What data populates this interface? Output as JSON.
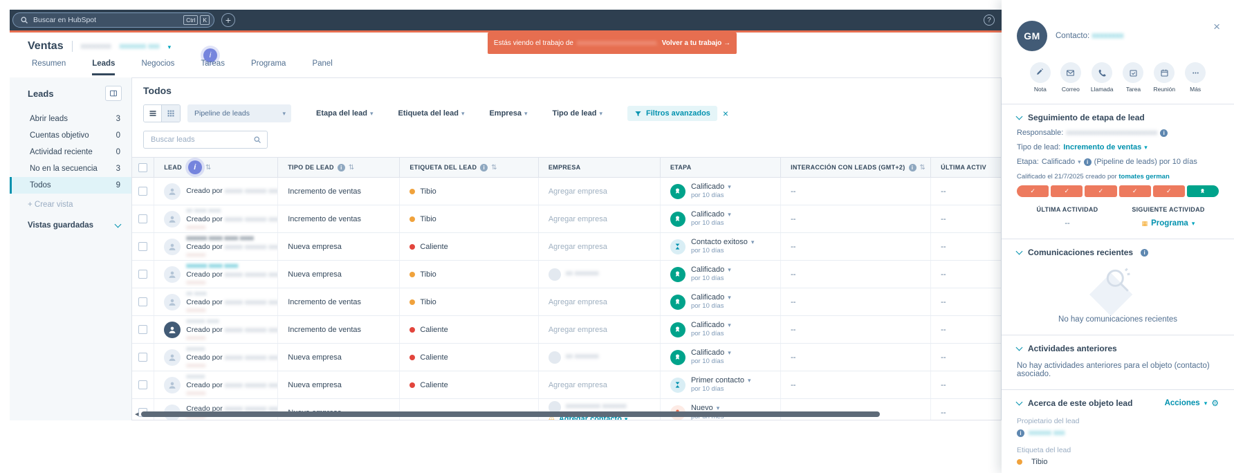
{
  "colors": {
    "navy": "#33475b",
    "teal": "#0091ae",
    "orange": "#e66e50",
    "green": "#00a38b",
    "amber": "#f5a623",
    "red": "#e2453c",
    "purple": "#7584dd"
  },
  "topbar": {
    "search_placeholder": "Buscar en HubSpot",
    "keys": [
      "Ctrl",
      "K"
    ]
  },
  "banner": {
    "prefix": "Estás viendo el trabajo de",
    "redacted": "xxxxxxxxxxxxxxxxxxxxxxx.",
    "action": "Volver a tu trabajo →"
  },
  "header": {
    "title": "Ventas",
    "sub1": "xxxxxxxx",
    "sub2": "xxxxxxx xxx",
    "tabs": [
      {
        "label": "Resumen",
        "active": false
      },
      {
        "label": "Leads",
        "active": true
      },
      {
        "label": "Negocios",
        "active": false
      },
      {
        "label": "Tareas",
        "active": false
      },
      {
        "label": "Programa",
        "active": false
      },
      {
        "label": "Panel",
        "active": false
      }
    ]
  },
  "sidebar": {
    "title": "Leads",
    "items": [
      {
        "label": "Abrir leads",
        "count": "3",
        "active": false
      },
      {
        "label": "Cuentas objetivo",
        "count": "0",
        "active": false
      },
      {
        "label": "Actividad reciente",
        "count": "0",
        "active": false
      },
      {
        "label": "No en la secuencia",
        "count": "3",
        "active": false
      },
      {
        "label": "Todos",
        "count": "9",
        "active": true
      }
    ],
    "create": "+ Crear vista",
    "saved": "Vistas guardadas"
  },
  "toolbar": {
    "heading": "Todos",
    "pipeline": "Pipeline de leads",
    "filters": [
      "Etapa del lead",
      "Etiqueta del lead",
      "Empresa",
      "Tipo de lead"
    ],
    "advanced": "Filtros avanzados",
    "search_placeholder": "Buscar leads"
  },
  "table": {
    "empty_value": "--",
    "columns": [
      {
        "label": "",
        "checkbox": true
      },
      {
        "label": "LEAD",
        "sort": true,
        "beacon": true
      },
      {
        "label": "TIPO DE LEAD",
        "info": true,
        "sort": true
      },
      {
        "label": "ETIQUETA DEL LEAD",
        "info": true,
        "sort": true
      },
      {
        "label": "EMPRESA"
      },
      {
        "label": "ETAPA"
      },
      {
        "label": "INTERACCIÓN CON LEADS (GMT+2)",
        "info": true,
        "sort": true
      },
      {
        "label": "ÚLTIMA ACTIV"
      }
    ],
    "rows": [
      {
        "avatar": "person",
        "name": "",
        "name_class": "",
        "creado": "Creado por",
        "creado_name": "xxxxx xxxxxx xxxxx",
        "sub": "",
        "tipo": "Incremento de ventas",
        "etiqueta": {
          "label": "Tibio",
          "color": "#f0a23c"
        },
        "empresa": {
          "type": "add",
          "label": "Agregar empresa"
        },
        "etapa": {
          "icon": "badge",
          "label": "Calificado",
          "sub": "por 10 días"
        },
        "interaccion": "--",
        "ultima": "--"
      },
      {
        "avatar": "person",
        "name": "xx xxxx xxxx",
        "name_class": "plain",
        "creado": "Creado por",
        "creado_name": "xxxxx xxxxxx xxxxx",
        "sub": "xxxxxxx",
        "tipo": "Incremento de ventas",
        "etiqueta": {
          "label": "Tibio",
          "color": "#f0a23c"
        },
        "empresa": {
          "type": "add",
          "label": "Agregar empresa"
        },
        "etapa": {
          "icon": "badge",
          "label": "Calificado",
          "sub": "por 10 días"
        },
        "interaccion": "--",
        "ultima": "--"
      },
      {
        "avatar": "person",
        "name": "xxxxxx xxxx xxxx xxxx",
        "name_class": "dark",
        "creado": "Creado por",
        "creado_name": "xxxxx xxxxxx xxxxx",
        "sub": "xxxxxxx",
        "tipo": "Nueva empresa",
        "etiqueta": {
          "label": "Caliente",
          "color": "#e2453c"
        },
        "empresa": {
          "type": "add",
          "label": "Agregar empresa"
        },
        "etapa": {
          "icon": "hourglass",
          "label": "Contacto exitoso",
          "sub": "por 10 días"
        },
        "interaccion": "--",
        "ultima": "--"
      },
      {
        "avatar": "person",
        "name": "xxxxxx xxxx xxxx",
        "name_class": "teal",
        "creado": "Creado por",
        "creado_name": "xxxxx xxxxxx xxxxx",
        "sub": "xxxxxxx",
        "tipo": "Nueva empresa",
        "etiqueta": {
          "label": "Tibio",
          "color": "#f0a23c"
        },
        "empresa": {
          "type": "company",
          "name": "xx xxxxxxx"
        },
        "etapa": {
          "icon": "badge",
          "label": "Calificado",
          "sub": "por 10 días"
        },
        "interaccion": "--",
        "ultima": "--"
      },
      {
        "avatar": "person",
        "name": "xx xxxx",
        "name_class": "plain",
        "creado": "Creado por",
        "creado_name": "xxxxx xxxxxx xxxxx",
        "sub": "xxxxxxx",
        "tipo": "Incremento de ventas",
        "etiqueta": {
          "label": "Tibio",
          "color": "#f0a23c"
        },
        "empresa": {
          "type": "add",
          "label": "Agregar empresa"
        },
        "etapa": {
          "icon": "badge",
          "label": "Calificado",
          "sub": "por 10 días"
        },
        "interaccion": "--",
        "ultima": "--"
      },
      {
        "avatar": "dark",
        "name": "xxxxxx xxxx",
        "name_class": "plain",
        "creado": "Creado por",
        "creado_name": "xxxxx xxxxxx xxxxx",
        "sub": "xxxxxxx",
        "tipo": "Incremento de ventas",
        "etiqueta": {
          "label": "Caliente",
          "color": "#e2453c"
        },
        "empresa": {
          "type": "add",
          "label": "Agregar empresa"
        },
        "etapa": {
          "icon": "badge",
          "label": "Calificado",
          "sub": "por 10 días"
        },
        "interaccion": "--",
        "ultima": "--"
      },
      {
        "avatar": "person",
        "name": "xxxxxx",
        "name_class": "plain",
        "creado": "Creado por",
        "creado_name": "xxxxx xxxxxx xxxxx",
        "sub": "xxxxxxx",
        "tipo": "Nueva empresa",
        "etiqueta": {
          "label": "Caliente",
          "color": "#e2453c"
        },
        "empresa": {
          "type": "company",
          "name": "xx xxxxxxx"
        },
        "etapa": {
          "icon": "badge",
          "label": "Calificado",
          "sub": "por 10 días"
        },
        "interaccion": "--",
        "ultima": "--"
      },
      {
        "avatar": "person",
        "name": "xxxxxx",
        "name_class": "plain",
        "creado": "Creado por",
        "creado_name": "xxxxx xxxxxx xxxxx",
        "sub": "xxxxxxx",
        "tipo": "Nueva empresa",
        "etiqueta": {
          "label": "Caliente",
          "color": "#e2453c"
        },
        "empresa": {
          "type": "add",
          "label": "Agregar empresa"
        },
        "etapa": {
          "icon": "hourglass",
          "label": "Primer contacto",
          "sub": "por 10 días"
        },
        "interaccion": "--",
        "ultima": "--"
      },
      {
        "avatar": "empty",
        "name": "",
        "name_class": "",
        "creado": "Creado por",
        "creado_name": "xxxxx xxxxxx xxxxx",
        "sub": "xxxxxxx",
        "tipo": "Nueva empresa",
        "etiqueta": null,
        "empresa": {
          "type": "company",
          "name": "xxxxxxxxxx xxxxxxx",
          "warn": "Agregar contacto"
        },
        "etapa": {
          "icon": "person",
          "label": "Nuevo",
          "sub": "por un mes"
        },
        "interaccion": "--",
        "ultima": "--"
      }
    ]
  },
  "panel": {
    "avatar_initials": "GM",
    "contact_label": "Contacto:",
    "contact_name": "xxxxxxxx",
    "actions": [
      {
        "icon": "note",
        "label": "Nota"
      },
      {
        "icon": "email",
        "label": "Correo"
      },
      {
        "icon": "call",
        "label": "Llamada"
      },
      {
        "icon": "task",
        "label": "Tarea"
      },
      {
        "icon": "meeting",
        "label": "Reunión"
      },
      {
        "icon": "more",
        "label": "Más"
      }
    ],
    "stage": {
      "title": "Seguimiento de etapa de lead",
      "responsable_label": "Responsable:",
      "responsable_value": "xxxxxxxxxxxxxxxxxxxxxxxx",
      "tipo_label": "Tipo de lead:",
      "tipo_value": "Incremento de ventas",
      "etapa_label": "Etapa:",
      "etapa_value": "Calificado",
      "etapa_suffix": "(Pipeline de leads) por 10 días",
      "note_prefix": "Calificado el 21/7/2025 creado por",
      "note_name": "tomates german",
      "progress": {
        "segments": 6,
        "completed": 5
      },
      "last_label": "ÚLTIMA ACTIVIDAD",
      "last_value": "--",
      "next_label": "SIGUIENTE ACTIVIDAD",
      "next_value": "Programa"
    },
    "comms": {
      "title": "Comunicaciones recientes",
      "empty": "No hay comunicaciones recientes"
    },
    "prev": {
      "title": "Actividades anteriores",
      "empty": "No hay actividades anteriores para el objeto (contacto) asociado."
    },
    "about": {
      "title": "Acerca de este objeto lead",
      "actions_label": "Acciones",
      "owner_label": "Propietario del lead",
      "owner_value": "xxxxxx xxx",
      "tag_label": "Etiqueta del lead",
      "tag_value": "Tibio",
      "tag_color": "#f0a23c"
    }
  }
}
